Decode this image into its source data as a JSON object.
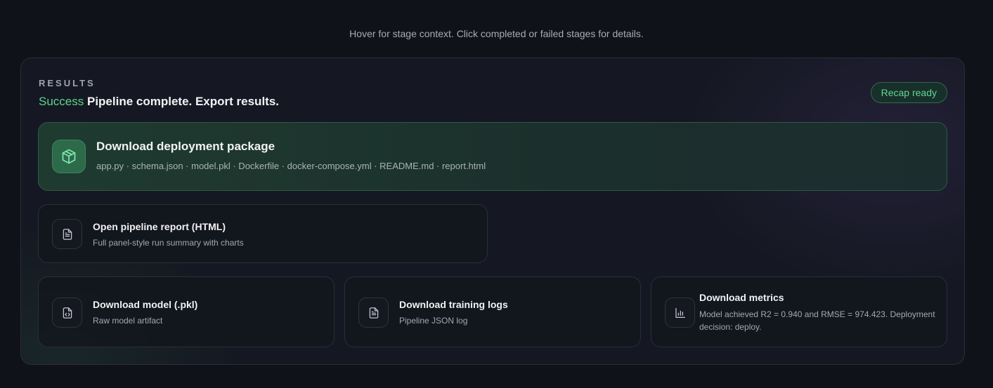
{
  "hint": "Hover for stage context. Click completed or failed stages for details.",
  "results": {
    "eyebrow": "RESULTS",
    "status": "Success",
    "message": "Pipeline complete. Export results.",
    "badge": "Recap ready"
  },
  "colors": {
    "success": "#5cd38e",
    "accent_bg": "#2c6a4a",
    "panel_bg": "#151822"
  },
  "cards": {
    "package": {
      "icon": "package-icon",
      "title": "Download deployment package",
      "files": "app.py · schema.json · model.pkl · Dockerfile · docker-compose.yml · README.md · report.html"
    },
    "report": {
      "icon": "document-icon",
      "title": "Open pipeline report (HTML)",
      "subtitle": "Full panel-style run summary with charts"
    },
    "model": {
      "icon": "code-file-icon",
      "title": "Download model (.pkl)",
      "subtitle": "Raw model artifact"
    },
    "logs": {
      "icon": "document-icon",
      "title": "Download training logs",
      "subtitle": "Pipeline JSON log"
    },
    "metrics": {
      "icon": "bar-chart-icon",
      "title": "Download metrics",
      "subtitle": "Model achieved R2 = 0.940 and RMSE = 974.423. Deployment decision: deploy."
    }
  }
}
